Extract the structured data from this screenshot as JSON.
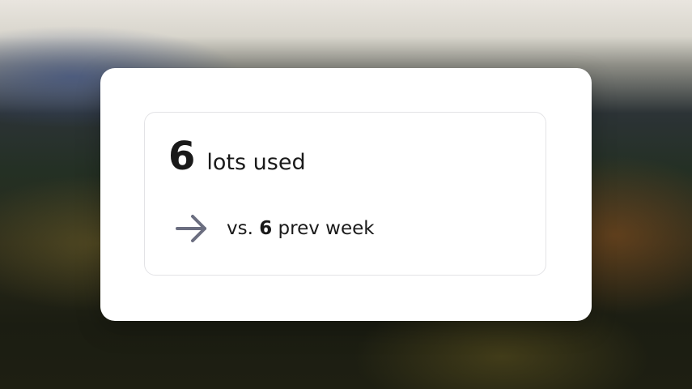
{
  "stat": {
    "value": "6",
    "label": "lots used"
  },
  "comparison": {
    "prefix": "vs.",
    "value": "6",
    "suffix": "prev week",
    "trend_icon": "arrow-right-icon",
    "trend_color": "#6b6e80"
  }
}
